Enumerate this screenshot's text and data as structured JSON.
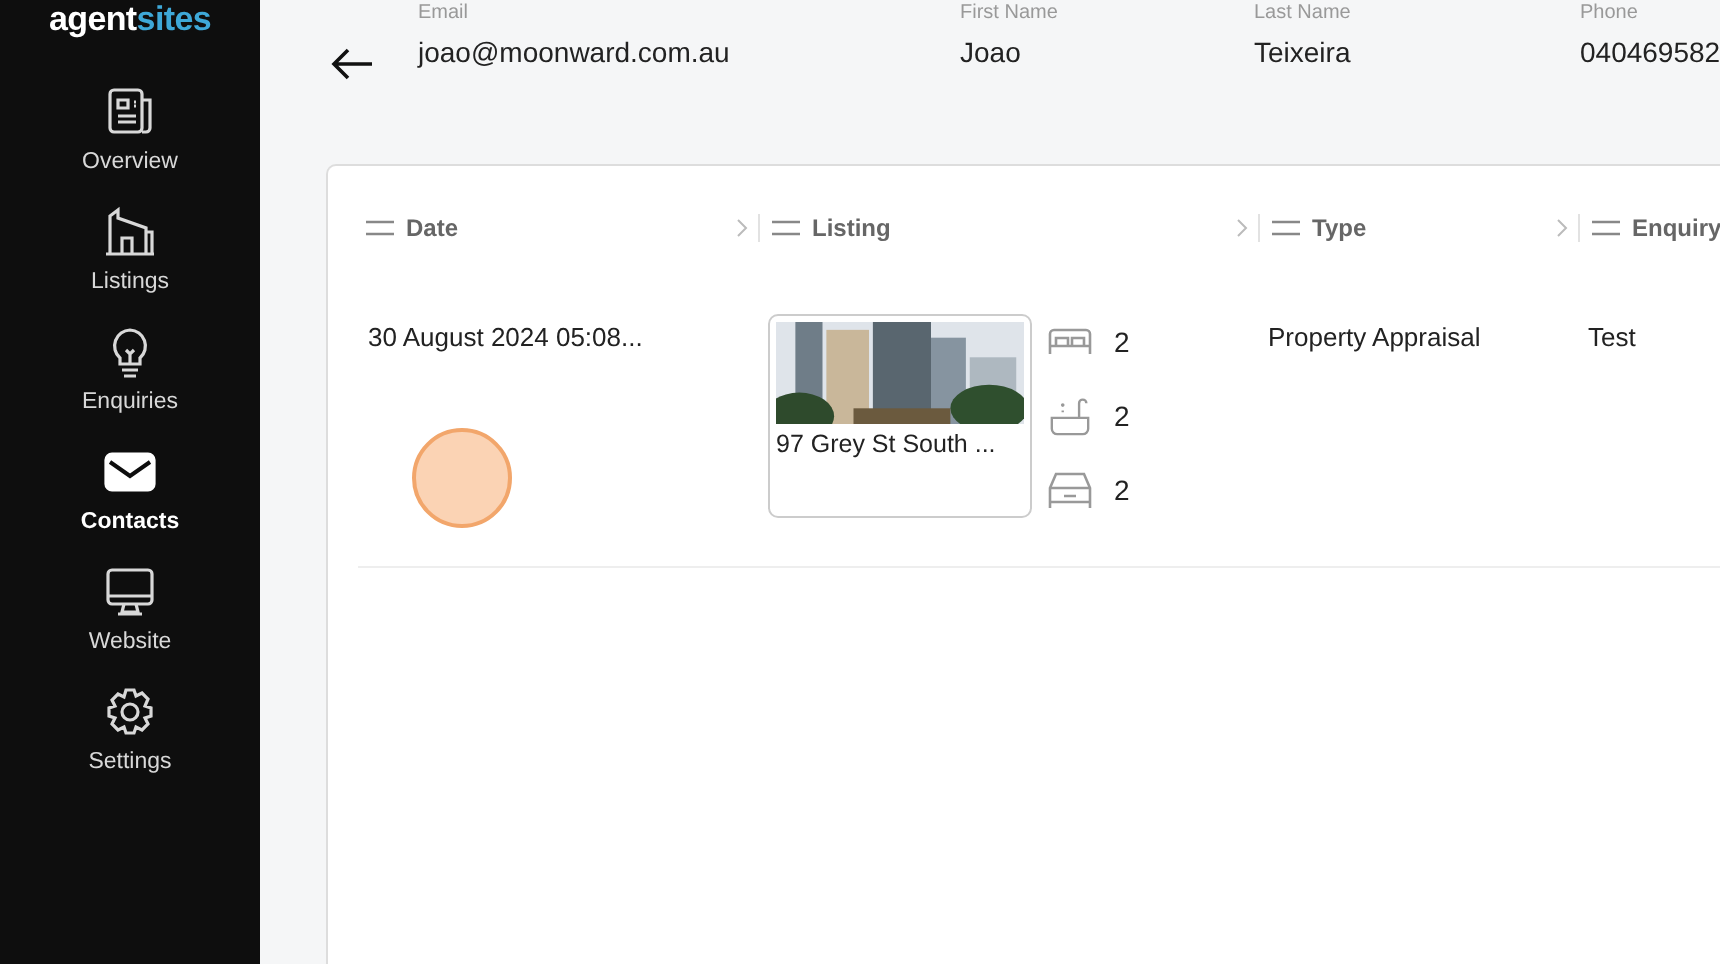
{
  "brand": {
    "part_1": "agent",
    "part_2": "sites"
  },
  "sidebar": {
    "items": [
      {
        "label": "Overview",
        "kind": "overview",
        "selected": false
      },
      {
        "label": "Listings",
        "kind": "listings",
        "selected": false
      },
      {
        "label": "Enquiries",
        "kind": "enquiries",
        "selected": false
      },
      {
        "label": "Contacts",
        "kind": "contacts",
        "selected": true
      },
      {
        "label": "Website",
        "kind": "website",
        "selected": false
      },
      {
        "label": "Settings",
        "kind": "settings",
        "selected": false
      }
    ]
  },
  "contact": {
    "fields": [
      {
        "label": "Email",
        "value": "joao@moonward.com.au"
      },
      {
        "label": "First Name",
        "value": "Joao"
      },
      {
        "label": "Last Name",
        "value": "Teixeira"
      },
      {
        "label": "Phone",
        "value": "040469582"
      }
    ]
  },
  "table": {
    "columns": [
      "Date",
      "Listing",
      "Type",
      "Enquiry"
    ],
    "rows": [
      {
        "date": "30 August 2024 05:08...",
        "listing": {
          "kind": "picture",
          "address": "97 Grey St South ...",
          "beds": "2",
          "baths": "2",
          "cars": "2"
        },
        "type": "Property Appraisal",
        "enquiry": "Test"
      }
    ]
  }
}
